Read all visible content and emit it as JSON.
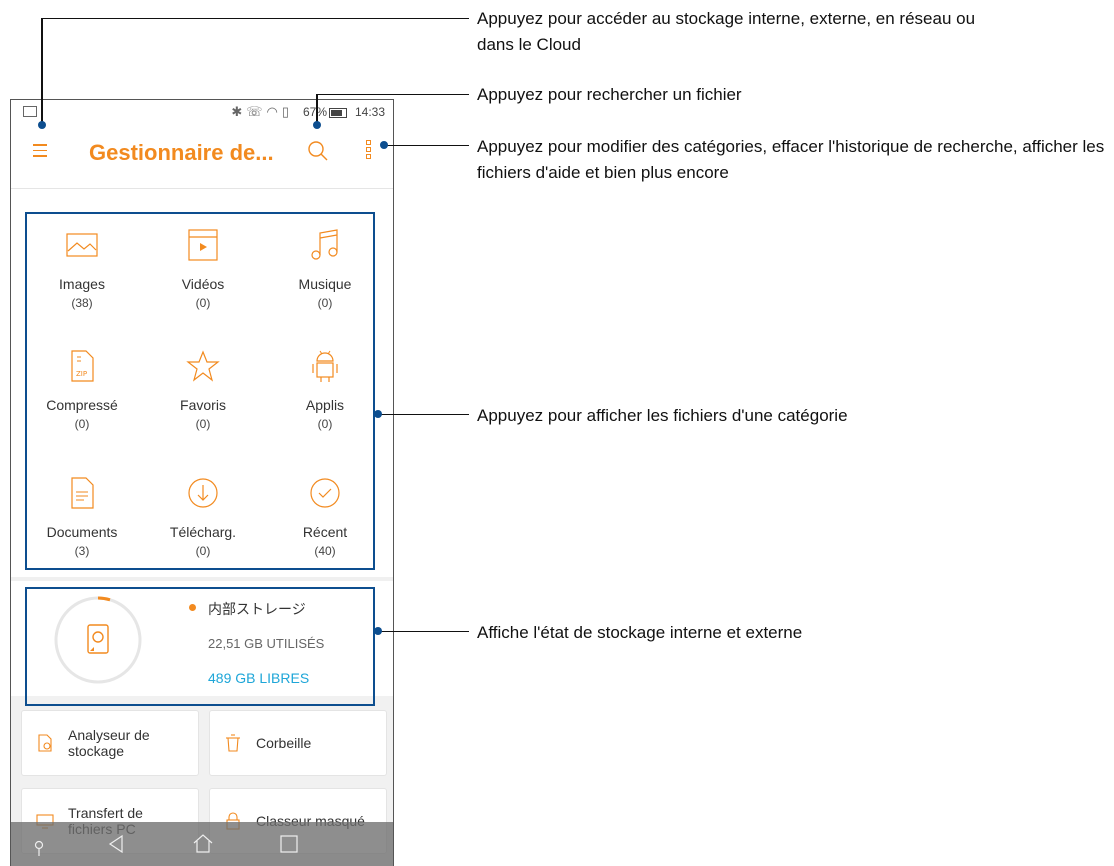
{
  "status_bar": {
    "battery": "67",
    "time": "14:33"
  },
  "app_bar": {
    "title": "Gestionnaire de..."
  },
  "categories": [
    {
      "label": "Images",
      "count": "(38)",
      "icon": "image-icon"
    },
    {
      "label": "Vidéos",
      "count": "(0)",
      "icon": "video-icon"
    },
    {
      "label": "Musique",
      "count": "(0)",
      "icon": "music-icon"
    },
    {
      "label": "Compressé",
      "count": "(0)",
      "icon": "zip-icon"
    },
    {
      "label": "Favoris",
      "count": "(0)",
      "icon": "star-icon"
    },
    {
      "label": "Applis",
      "count": "(0)",
      "icon": "android-icon"
    },
    {
      "label": "Documents",
      "count": "(3)",
      "icon": "document-icon"
    },
    {
      "label": "Télécharg.",
      "count": "(0)",
      "icon": "download-icon"
    },
    {
      "label": "Récent",
      "count": "(40)",
      "icon": "check-circle-icon"
    }
  ],
  "storage": {
    "name": "内部ストレージ",
    "used": "22,51 GB UTILISÉS",
    "free": "489 GB LIBRES"
  },
  "tools": [
    {
      "label": "Analyseur de stockage"
    },
    {
      "label": "Corbeille"
    },
    {
      "label": "Transfert de fichiers PC"
    },
    {
      "label": "Classeur masqué"
    }
  ],
  "callouts": {
    "storage_access": "Appuyez pour accéder au stockage interne, externe, en réseau ou dans le Cloud",
    "search": "Appuyez pour rechercher un fichier",
    "menu": "Appuyez pour modifier des catégories, effacer l'historique de recherche, afficher les fichiers d'aide et bien plus encore",
    "categories": "Appuyez pour afficher les fichiers d'une catégorie",
    "storage_status": "Affiche l'état de stockage interne et externe"
  },
  "colors": {
    "accent": "#f28a1f",
    "free_storage": "#1ea6d8",
    "highlight": "#0d4e8f"
  }
}
